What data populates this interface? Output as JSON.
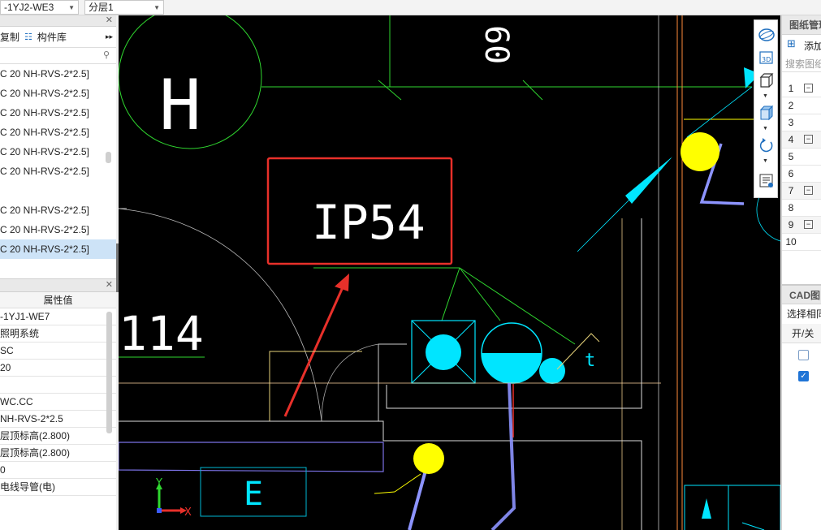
{
  "top": {
    "layer_select": "-1YJ2-WE3",
    "floor_select": "分层1"
  },
  "left": {
    "tools": {
      "copy": "复制",
      "library": "构件库"
    },
    "items": [
      "C 20 NH-RVS-2*2.5]",
      "C 20 NH-RVS-2*2.5]",
      "C 20 NH-RVS-2*2.5]",
      "C 20 NH-RVS-2*2.5]",
      "C 20 NH-RVS-2*2.5]",
      "C 20 NH-RVS-2*2.5]",
      "",
      "C 20 NH-RVS-2*2.5]",
      "C 20 NH-RVS-2*2.5]",
      "C 20 NH-RVS-2*2.5]"
    ],
    "selected_index": 9,
    "props_header": "属性值",
    "props": [
      "-1YJ1-WE7",
      "照明系统",
      "SC",
      "20",
      "",
      "WC.CC",
      "NH-RVS-2*2.5",
      "层顶标高(2.800)",
      "层顶标高(2.800)",
      "0",
      "电线导管(电)"
    ]
  },
  "canvas": {
    "axis_label": "H",
    "rotated_text": "60",
    "room_label": "IP54",
    "dim_text": "114",
    "box_label": "E",
    "y_label": "Y",
    "x_label": "X",
    "t_label": "t"
  },
  "view_tools": [
    "orbit-icon",
    "view-3d-icon",
    "cube-icon",
    "shaded-cube-icon",
    "rotate-icon",
    "layer-list-icon"
  ],
  "right": {
    "panel1_title": "图纸管理",
    "add_label": "添加",
    "search_placeholder": "搜索图纸",
    "rows": [
      "1",
      "2",
      "3",
      "4",
      "5",
      "6",
      "7",
      "8",
      "9",
      "10"
    ],
    "panel2_title": "CAD图",
    "select_label": "选择相同",
    "onoff_label": "开/关"
  },
  "colors": {
    "accent": "#cde3f7",
    "red_box": "#e8302a",
    "cyan": "#00e5ff",
    "yellow": "#ffff00",
    "green": "#2fd62f"
  }
}
